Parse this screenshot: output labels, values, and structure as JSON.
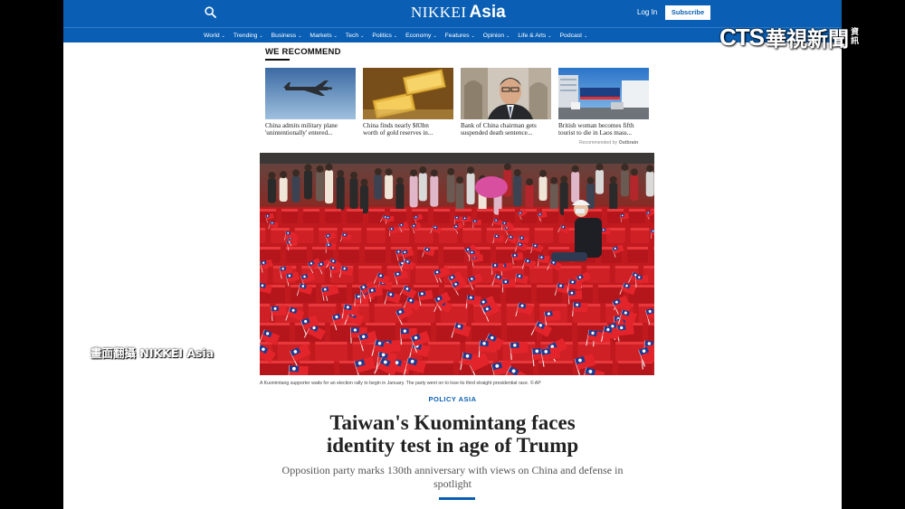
{
  "header": {
    "logo_part1": "NIKKEI",
    "logo_part2": "Asia",
    "login_label": "Log In",
    "subscribe_label": "Subscribe",
    "brand_color": "#0a5fb4"
  },
  "nav": {
    "items": [
      {
        "label": "World"
      },
      {
        "label": "Trending"
      },
      {
        "label": "Business"
      },
      {
        "label": "Markets"
      },
      {
        "label": "Tech"
      },
      {
        "label": "Politics"
      },
      {
        "label": "Economy"
      },
      {
        "label": "Features"
      },
      {
        "label": "Opinion"
      },
      {
        "label": "Life & Arts"
      },
      {
        "label": "Podcast"
      }
    ],
    "chevron": "⌄"
  },
  "recommend": {
    "title": "WE RECOMMEND",
    "cards": [
      {
        "caption_line1": "China admits military plane",
        "caption_line2": "'unintentionally' entered..."
      },
      {
        "caption_line1": "China finds nearly $83bn",
        "caption_line2": "worth of gold reserves in..."
      },
      {
        "caption_line1": "Bank of China chairman gets",
        "caption_line2": "suspended death sentence..."
      },
      {
        "caption_line1": "British woman becomes fifth",
        "caption_line2": "tourist to die in Laos mass..."
      }
    ],
    "attribution_prefix": "Recommended by",
    "attribution_brand": "Outbrain"
  },
  "article": {
    "photo_caption": "A Kuomintang supporter waits for an election rally to begin in January. The party went on to lose its third straight presidential race. © AP",
    "kicker": "POLICY ASIA",
    "headline_line1": "Taiwan's Kuomintang faces",
    "headline_line2": "identity test in age of Trump",
    "dek": "Opposition party marks 130th anniversary with views on China and defense in spotlight"
  },
  "overlay": {
    "channel_logo_latin": "CTS",
    "channel_logo_cjk": "華視新聞",
    "channel_logo_small": "資訊",
    "screen_credit": "畫面翻攝 NIKKEI Asia"
  }
}
